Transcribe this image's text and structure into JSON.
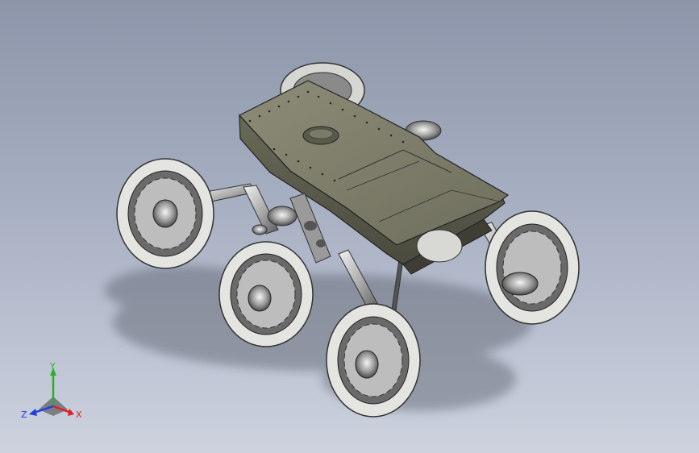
{
  "viewport": {
    "background_top": "#8c95a9",
    "background_bottom": "#cdd2de"
  },
  "model": {
    "body_color": "#7f7f6c",
    "body_dark": "#4f4f42",
    "metal_color": "#c9c9c9",
    "tire_color": "#e0e0dc"
  },
  "triad": {
    "x_label": "X",
    "y_label": "Y",
    "z_label": "Z",
    "x_color": "#e02020",
    "y_color": "#2ab02a",
    "z_color": "#2040e0"
  }
}
